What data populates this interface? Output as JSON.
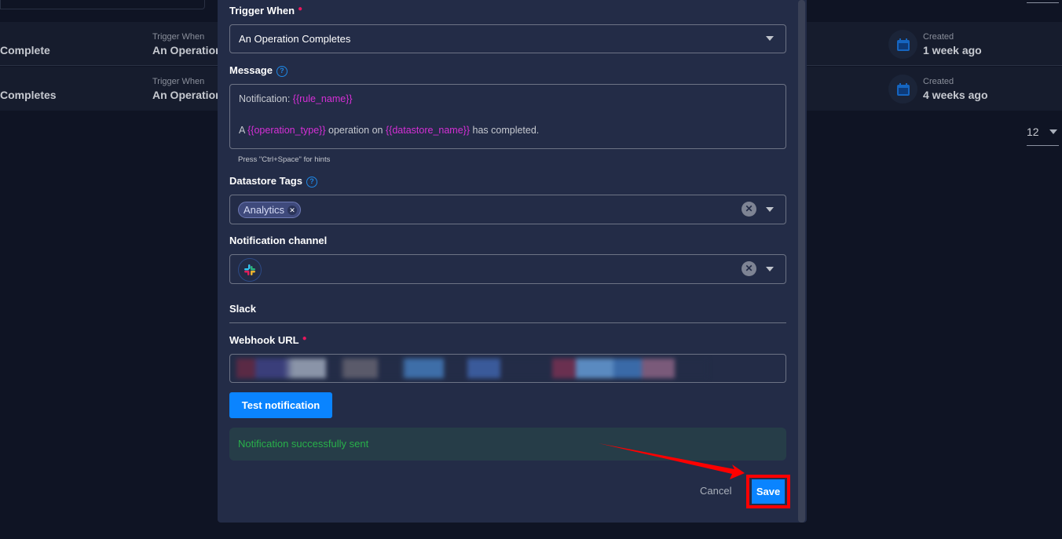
{
  "list": {
    "rows": [
      {
        "name": "Complete",
        "trigger_label": "Trigger When",
        "trigger_value": "An Operation Completes",
        "created_label": "Created",
        "created_value": "1 week ago"
      },
      {
        "name": "Completes",
        "trigger_label": "Trigger When",
        "trigger_value": "An Operation Completes",
        "created_label": "Created",
        "created_value": "4 weeks ago"
      }
    ],
    "page_size": "12"
  },
  "modal": {
    "trigger_label": "Trigger When",
    "trigger_value": "An Operation Completes",
    "message_label": "Message",
    "message": {
      "l1_prefix": "Notification: ",
      "l1_var": "{{rule_name}}",
      "l2_a": "A ",
      "l2_var1": "{{operation_type}}",
      "l2_b": " operation on ",
      "l2_var2": "{{datastore_name}}",
      "l2_c": " has completed."
    },
    "hint": "Press \"Ctrl+Space\" for hints",
    "tags_label": "Datastore Tags",
    "tags": [
      "Analytics"
    ],
    "channel_label": "Notification channel",
    "channel_icon": "slack-icon",
    "section_title": "Slack",
    "webhook_label": "Webhook URL",
    "test_button": "Test notification",
    "success_message": "Notification successfully sent",
    "cancel": "Cancel",
    "save": "Save"
  },
  "colors": {
    "accent": "#0a84ff",
    "success": "#28b04a",
    "highlight": "#ff0000",
    "variable": "#d62fd6"
  }
}
